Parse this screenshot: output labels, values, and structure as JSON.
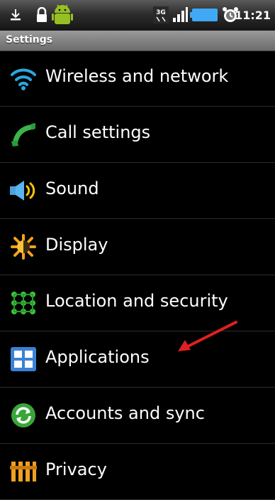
{
  "status_bar": {
    "time": "11:21",
    "icons": [
      "download-icon",
      "lock-icon",
      "android-icon",
      "3g-icon",
      "signal-icon",
      "battery-icon",
      "alarm-icon"
    ]
  },
  "title_bar": {
    "title": "Settings"
  },
  "settings": {
    "items": [
      {
        "label": "Wireless and network",
        "icon": "wifi-icon"
      },
      {
        "label": "Call settings",
        "icon": "phone-icon"
      },
      {
        "label": "Sound",
        "icon": "speaker-icon"
      },
      {
        "label": "Display",
        "icon": "brightness-icon"
      },
      {
        "label": "Location and security",
        "icon": "location-grid-icon"
      },
      {
        "label": "Applications",
        "icon": "applications-icon"
      },
      {
        "label": "Accounts and sync",
        "icon": "sync-icon"
      },
      {
        "label": "Privacy",
        "icon": "privacy-icon"
      }
    ]
  },
  "colors": {
    "background": "#000000",
    "title_bar": "#7a7a7a",
    "annotation_arrow": "#e02020"
  }
}
